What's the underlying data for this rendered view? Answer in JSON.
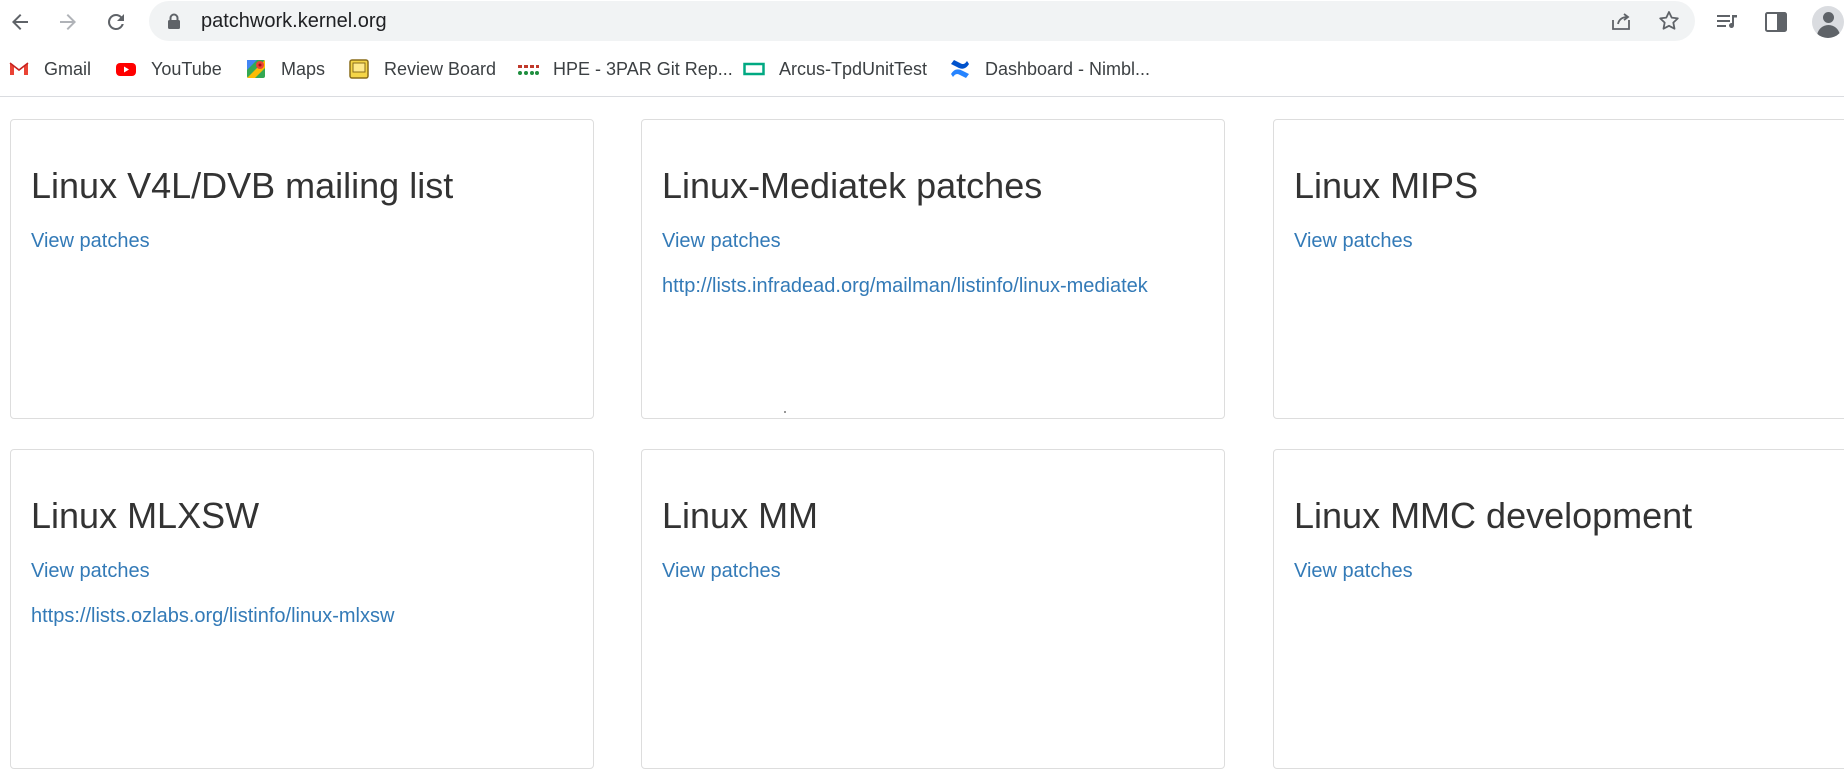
{
  "browser": {
    "url": "patchwork.kernel.org",
    "icons": {
      "back": "arrow-left-icon",
      "forward": "arrow-right-icon",
      "reload": "reload-icon",
      "lock": "lock-icon",
      "share": "share-icon",
      "star": "star-icon",
      "media": "media-queue-icon",
      "sidepanel": "side-panel-icon",
      "profile": "profile-icon"
    },
    "bookmarks": [
      {
        "label": "Gmail"
      },
      {
        "label": "YouTube"
      },
      {
        "label": "Maps"
      },
      {
        "label": "Review Board"
      },
      {
        "label": "HPE - 3PAR Git Rep..."
      },
      {
        "label": "Arcus-TpdUnitTest"
      },
      {
        "label": "Dashboard - Nimbl..."
      }
    ]
  },
  "projects": [
    {
      "title": "Linux V4L/DVB mailing list",
      "view_link": "View patches",
      "list_link": ""
    },
    {
      "title": "Linux-Mediatek patches",
      "view_link": "View patches",
      "list_link": "http://lists.infradead.org/mailman/listinfo/linux-mediatek"
    },
    {
      "title": "Linux MIPS",
      "view_link": "View patches",
      "list_link": ""
    },
    {
      "title": "Linux MLXSW",
      "view_link": "View patches",
      "list_link": "https://lists.ozlabs.org/listinfo/linux-mlxsw"
    },
    {
      "title": "Linux MM",
      "view_link": "View patches",
      "list_link": ""
    },
    {
      "title": "Linux MMC development",
      "view_link": "View patches",
      "list_link": ""
    }
  ],
  "colors": {
    "link": "#337ab7",
    "heading": "#333333",
    "card_border": "#dddddd",
    "omnibox_bg": "#f1f3f4"
  }
}
